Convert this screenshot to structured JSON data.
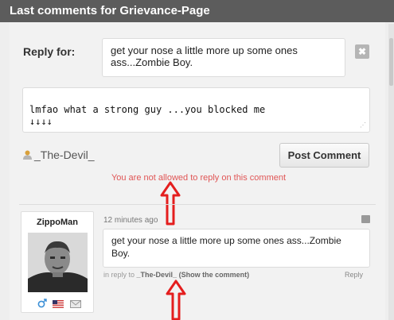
{
  "header": {
    "title": "Last comments for Grievance-Page"
  },
  "reply_form": {
    "label": "Reply for:",
    "quoted_text": "get your nose a little more up some ones ass...Zombie Boy.",
    "close_label": "✖",
    "textarea_value": "lmfao what a strong guy ...you blocked me\n↓↓↓↓",
    "username": "_The-Devil_",
    "submit_label": "Post Comment",
    "warning": "You are not allowed to reply on this comment"
  },
  "comment": {
    "author": "ZippoMan",
    "time": "12 minutes ago",
    "text": "get your nose a little more up some ones ass...Zombie Boy.",
    "meta_prefix": "in reply to",
    "meta_user": "_The-Devil_",
    "meta_link": "(Show the comment)",
    "reply_label": "Reply"
  },
  "colors": {
    "accent": "#e05555",
    "titlebar": "#5c5c5c",
    "arrow": "#e41e1e"
  }
}
